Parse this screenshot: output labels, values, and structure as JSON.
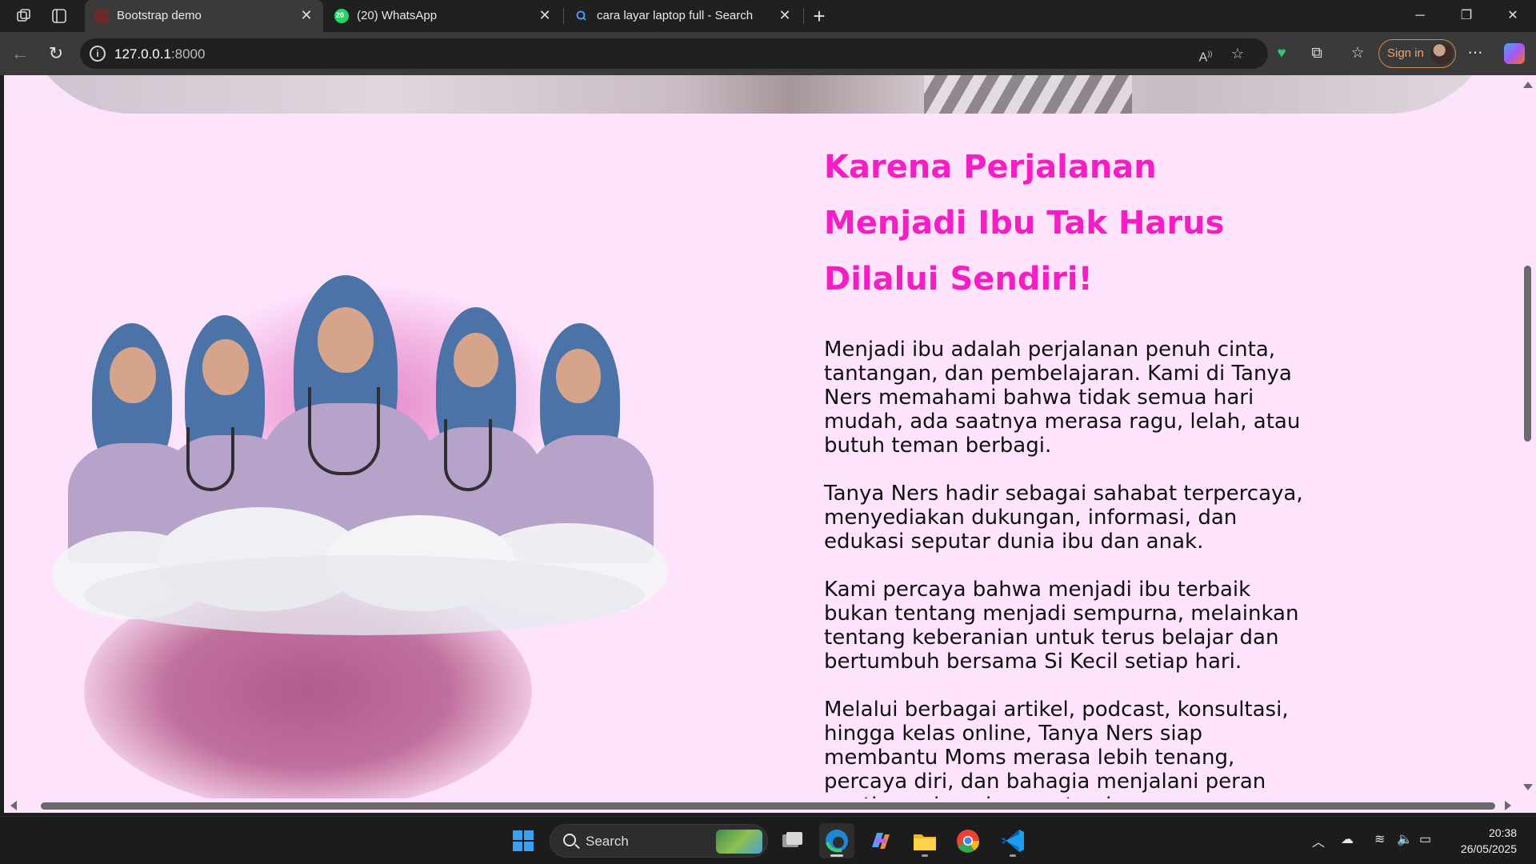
{
  "browser": {
    "tabs": [
      {
        "title": "Bootstrap demo",
        "active": true
      },
      {
        "title": "(20) WhatsApp",
        "badge": "20",
        "active": false
      },
      {
        "title": "cara layar laptop full - Search",
        "active": false
      }
    ],
    "url_host": "127.0.0.1",
    "url_port": ":8000",
    "signin_label": "Sign in"
  },
  "page": {
    "headline": "Karena Perjalanan Menjadi Ibu Tak Harus Dilalui Sendiri!",
    "paragraphs": [
      "Menjadi ibu adalah perjalanan penuh cinta, tantangan, dan pembelajaran. Kami di Tanya Ners memahami bahwa tidak semua hari mudah, ada saatnya merasa ragu, lelah, atau butuh teman berbagi.",
      "Tanya Ners hadir sebagai sahabat terpercaya, menyediakan dukungan, informasi, dan edukasi seputar dunia ibu dan anak.",
      "Kami percaya bahwa menjadi ibu terbaik bukan tentang menjadi sempurna, melainkan tentang keberanian untuk terus belajar dan bertumbuh bersama Si Kecil setiap hari.",
      "Melalui berbagai artikel, podcast, konsultasi, hingga kelas online, Tanya Ners siap membantu Moms merasa lebih tenang, percaya diri, dan bahagia menjalani peran penting sebagai orang tua baru."
    ],
    "colors": {
      "background": "#fde3fc",
      "headline": "#f41ec5"
    }
  },
  "taskbar": {
    "search_label": "Search",
    "time": "20:38",
    "date": "26/05/2025",
    "pinned": [
      "windows-start-icon",
      "task-view-icon",
      "edge-icon",
      "copilot-icon",
      "file-explorer-icon",
      "chrome-icon",
      "vscode-icon"
    ]
  }
}
